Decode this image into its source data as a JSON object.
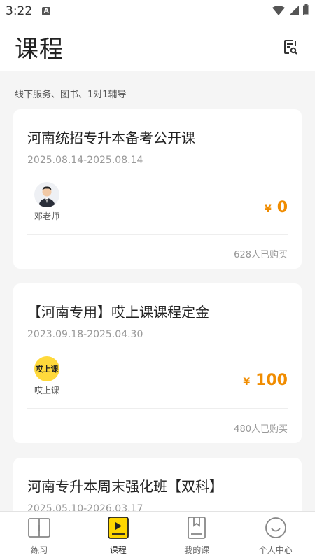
{
  "status": {
    "time": "3:22",
    "notif": "A"
  },
  "header": {
    "title": "课程"
  },
  "caption": "线下服务、图书、1对1辅导",
  "courses": [
    {
      "title": "河南统招专升本备考公开课",
      "date": "2025.08.14-2025.08.14",
      "teacher": "邓老师",
      "currency": "¥",
      "price": "0",
      "sold": "628人已购买"
    },
    {
      "title": "【河南专用】哎上课课程定金",
      "date": "2023.09.18-2025.04.30",
      "teacher": "哎上课",
      "teacher_logo_text": "哎上课",
      "currency": "¥",
      "price": "100",
      "sold": "480人已购买"
    },
    {
      "title": "河南专升本周末强化班【双科】",
      "date": "2025.05.10-2026.03.17"
    }
  ],
  "tabs": [
    {
      "label": "练习",
      "icon": "practice-book-icon"
    },
    {
      "label": "课程",
      "icon": "course-play-icon",
      "active": true
    },
    {
      "label": "我的课",
      "icon": "my-course-icon"
    },
    {
      "label": "个人中心",
      "icon": "profile-smile-icon"
    }
  ],
  "colors": {
    "accent": "#f08c00",
    "active_tab": "#ffd600"
  }
}
